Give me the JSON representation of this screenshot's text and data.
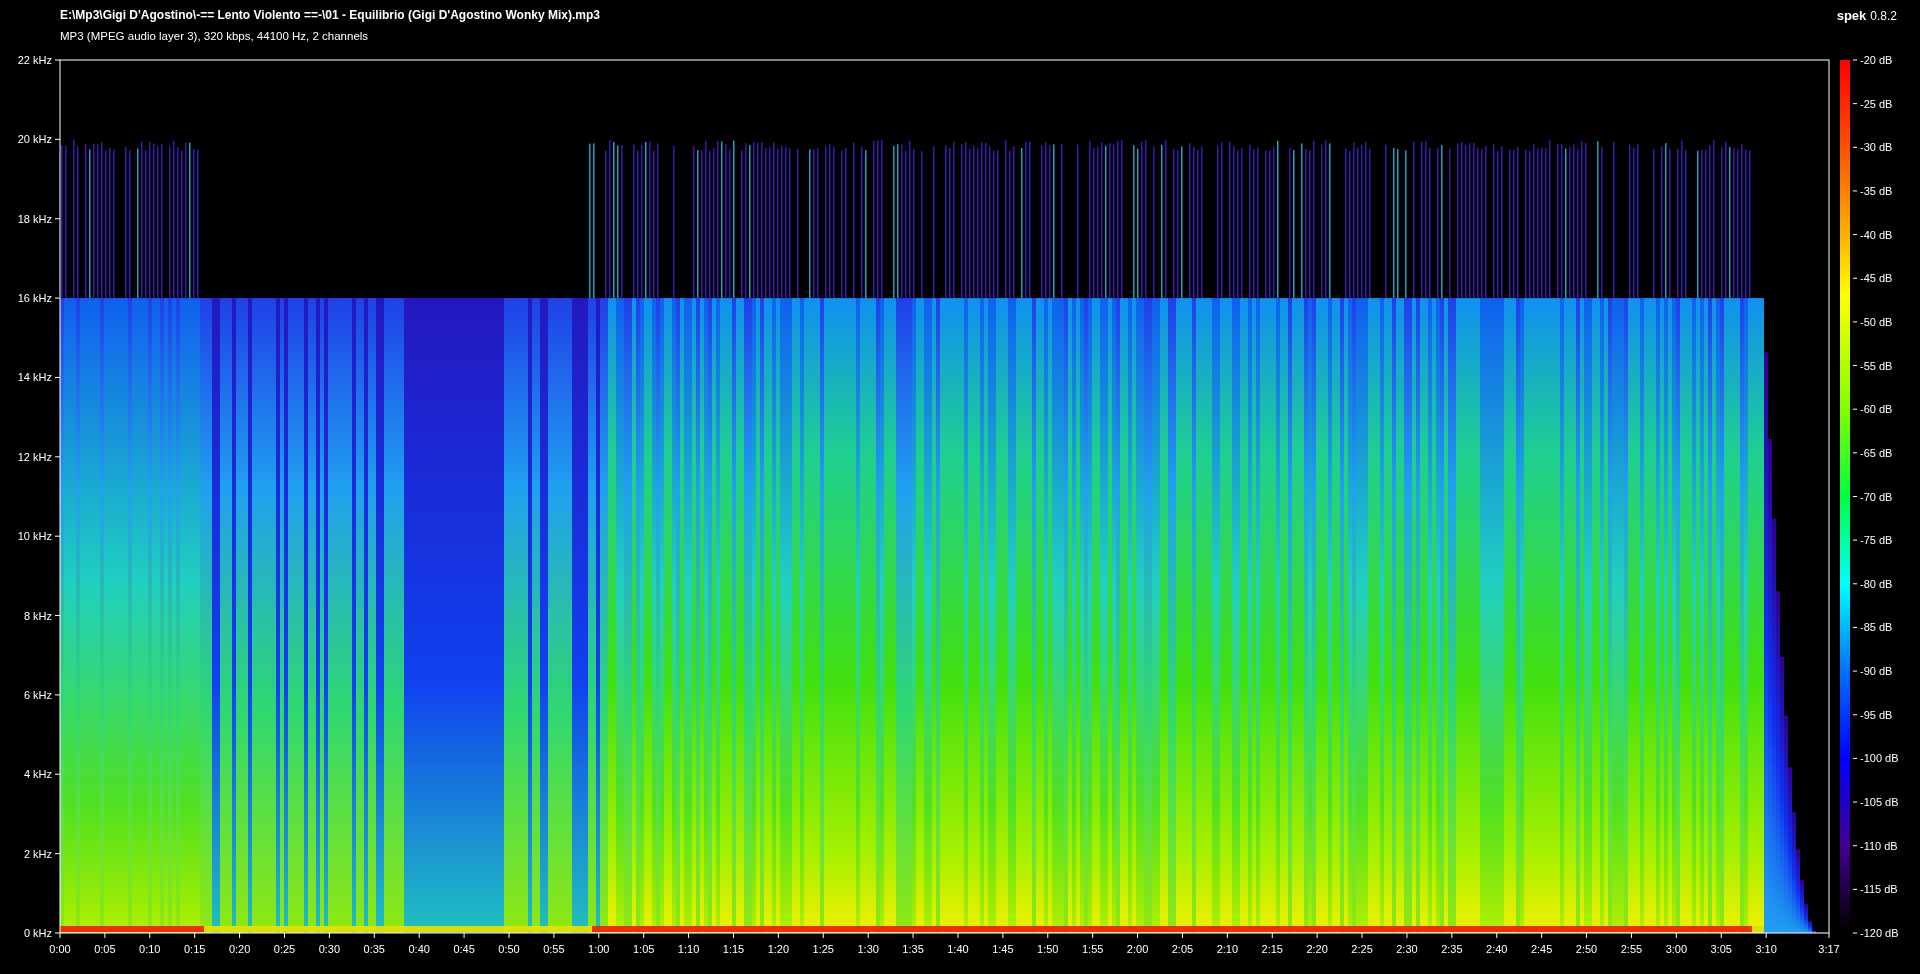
{
  "title": "E:\\Mp3\\Gigi D'Agostino\\-== Lento Violento ==-\\01 - Equilibrio (Gigi D'Agostino Wonky Mix).mp3",
  "file_info": "MP3 (MPEG audio layer 3), 320 kbps, 44100 Hz, 2 channels",
  "app": {
    "name": "spek",
    "version": "0.8.2"
  },
  "frequency_axis": [
    "22 kHz",
    "20 kHz",
    "18 kHz",
    "16 kHz",
    "14 kHz",
    "12 kHz",
    "10 kHz",
    "8 kHz",
    "6 kHz",
    "4 kHz",
    "2 kHz",
    "0 kHz"
  ],
  "time_axis": [
    "0:00",
    "0:05",
    "0:10",
    "0:15",
    "0:20",
    "0:25",
    "0:30",
    "0:35",
    "0:40",
    "0:45",
    "0:50",
    "0:55",
    "1:00",
    "1:05",
    "1:10",
    "1:15",
    "1:20",
    "1:25",
    "1:30",
    "1:35",
    "1:40",
    "1:45",
    "1:50",
    "1:55",
    "2:00",
    "2:05",
    "2:10",
    "2:15",
    "2:20",
    "2:25",
    "2:30",
    "2:35",
    "2:40",
    "2:45",
    "2:50",
    "2:55",
    "3:00",
    "3:05",
    "3:10",
    "3:17"
  ],
  "level_legend": [
    "-20 dB",
    "-25 dB",
    "-30 dB",
    "-35 dB",
    "-40 dB",
    "-45 dB",
    "-50 dB",
    "-55 dB",
    "-60 dB",
    "-65 dB",
    "-70 dB",
    "-75 dB",
    "-80 dB",
    "-85 dB",
    "-90 dB",
    "-95 dB",
    "-100 dB",
    "-105 dB",
    "-110 dB",
    "-115 dB",
    "-120 dB"
  ]
}
